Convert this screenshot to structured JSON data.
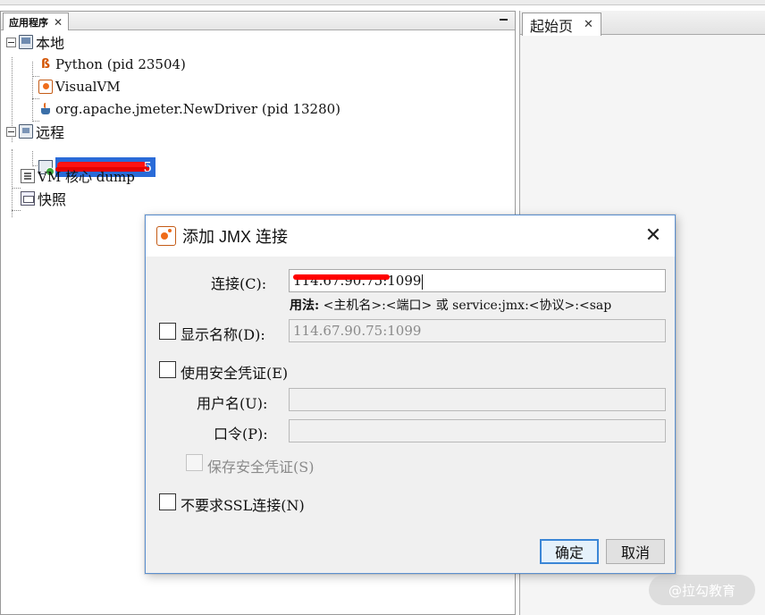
{
  "left_panel": {
    "tab_label": "应用程序",
    "tree": {
      "local": {
        "label": "本地",
        "children": [
          {
            "label": "Python (pid 23504)",
            "icon": "python-jvm-icon"
          },
          {
            "label": "VisualVM",
            "icon": "visualvm-icon"
          },
          {
            "label": "org.apache.jmeter.NewDriver (pid 13280)",
            "icon": "java-coffee-icon"
          }
        ]
      },
      "remote": {
        "label": "远程",
        "host_label_tail": "5"
      },
      "vm_core_dump": "VM 核心 dump",
      "snapshots": "快照"
    }
  },
  "right_panel": {
    "tab_label": "起始页"
  },
  "dialog": {
    "title": "添加 JMX 连接",
    "connection_label": "连接(C):",
    "connection_value": "114.67.90.75:1099",
    "usage_bold": "用法:",
    "usage_text": "<主机名>:<端口> 或 service:jmx:<协议>:<sap",
    "display_name_label": "显示名称(D):",
    "display_name_value": "114.67.90.75:1099",
    "use_credentials_label": "使用安全凭证(E)",
    "username_label": "用户名(U):",
    "password_label": "口令(P):",
    "save_credentials_label": "保存安全凭证(S)",
    "no_ssl_label": "不要求SSL连接(N)",
    "ok_label": "确定",
    "cancel_label": "取消"
  },
  "watermark": "@拉勾教育",
  "colors": {
    "selection": "#2a6bd8",
    "dialog_border": "#5b8fcf",
    "primary_button_border": "#3b86d6",
    "redaction": "#ff1212"
  }
}
